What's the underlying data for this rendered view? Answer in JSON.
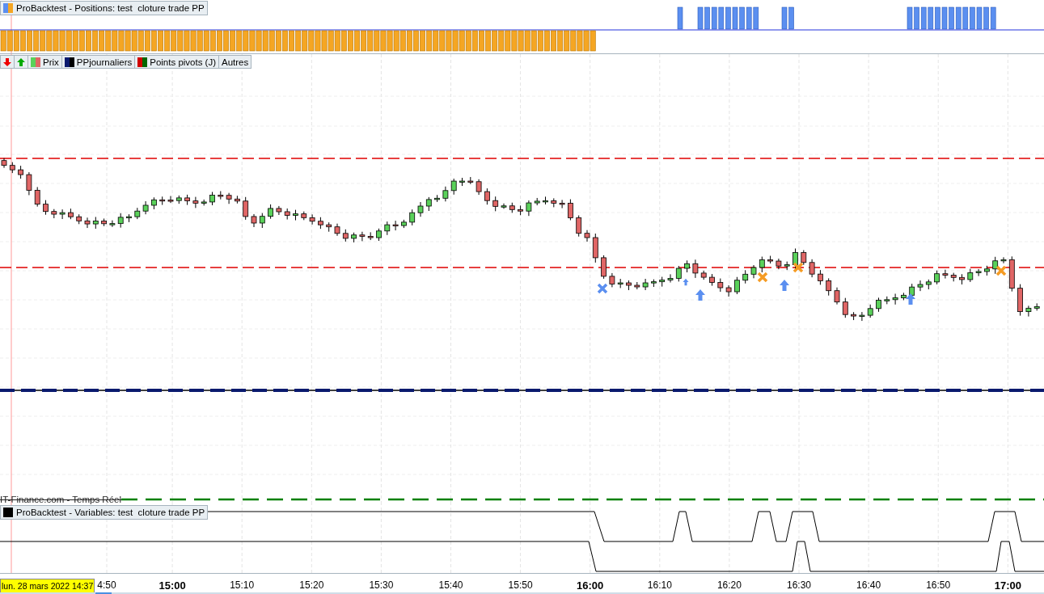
{
  "positions_panel": {
    "title": "ProBacktest - Positions: test  cloture trade PP"
  },
  "price_panel": {
    "legend": [
      {
        "kind": "down-button"
      },
      {
        "kind": "up-button"
      },
      {
        "kind": "series",
        "label": "Prix"
      },
      {
        "kind": "series",
        "label": "PPjournaliers"
      },
      {
        "kind": "series",
        "label": "Points pivots (J)"
      },
      {
        "kind": "plain",
        "label": "Autres"
      }
    ],
    "source": "IT-Finance.com - Temps Réel"
  },
  "variables_panel": {
    "title": "ProBacktest - Variables: test  cloture trade PP"
  },
  "time_axis": {
    "cursor_date": "lun. 28 mars 2022 14:37",
    "ticks": [
      {
        "label": "4:50",
        "major": false
      },
      {
        "label": "15:00",
        "major": true
      },
      {
        "label": "15:10",
        "major": false
      },
      {
        "label": "15:20",
        "major": false
      },
      {
        "label": "15:30",
        "major": false
      },
      {
        "label": "15:40",
        "major": false
      },
      {
        "label": "15:50",
        "major": false
      },
      {
        "label": "16:00",
        "major": true
      },
      {
        "label": "16:10",
        "major": false
      },
      {
        "label": "16:20",
        "major": false
      },
      {
        "label": "16:30",
        "major": false
      },
      {
        "label": "16:40",
        "major": false
      },
      {
        "label": "16:50",
        "major": false
      },
      {
        "label": "17:00",
        "major": true
      }
    ]
  }
}
